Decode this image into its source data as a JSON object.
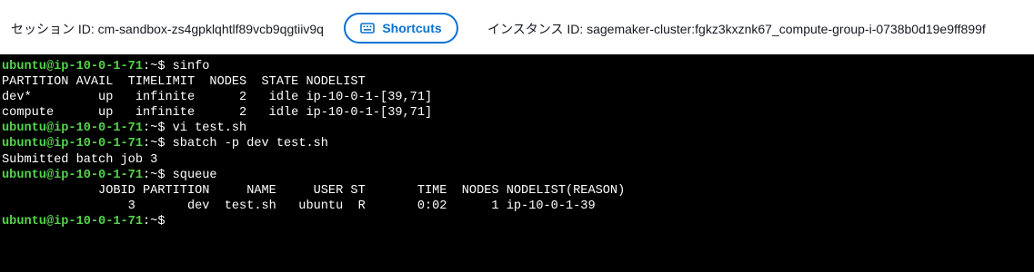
{
  "header": {
    "session_label": "セッション ID: cm-sandbox-zs4gpklqhtlf89vcb9qgtiiv9q",
    "shortcuts_label": "Shortcuts",
    "instance_label": "インスタンス ID: sagemaker-cluster:fgkz3kxznk67_compute-group-i-0738b0d19e9ff899f",
    "accent_color": "#0972d3"
  },
  "terminal": {
    "prompt_user_host": "ubuntu@ip-10-0-1-71",
    "prompt_suffix": ":~$ ",
    "prompt_color": "#54d34c",
    "lines": [
      {
        "type": "prompt",
        "cmd": "sinfo"
      },
      {
        "type": "output",
        "text": "PARTITION AVAIL  TIMELIMIT  NODES  STATE NODELIST"
      },
      {
        "type": "output",
        "text": "dev*         up   infinite      2   idle ip-10-0-1-[39,71]"
      },
      {
        "type": "output",
        "text": "compute      up   infinite      2   idle ip-10-0-1-[39,71]"
      },
      {
        "type": "prompt",
        "cmd": "vi test.sh"
      },
      {
        "type": "prompt",
        "cmd": "sbatch -p dev test.sh"
      },
      {
        "type": "output",
        "text": "Submitted batch job 3"
      },
      {
        "type": "prompt",
        "cmd": "squeue"
      },
      {
        "type": "output",
        "text": "             JOBID PARTITION     NAME     USER ST       TIME  NODES NODELIST(REASON)"
      },
      {
        "type": "output",
        "text": "                 3       dev  test.sh   ubuntu  R       0:02      1 ip-10-0-1-39"
      },
      {
        "type": "prompt",
        "cmd": ""
      }
    ]
  }
}
